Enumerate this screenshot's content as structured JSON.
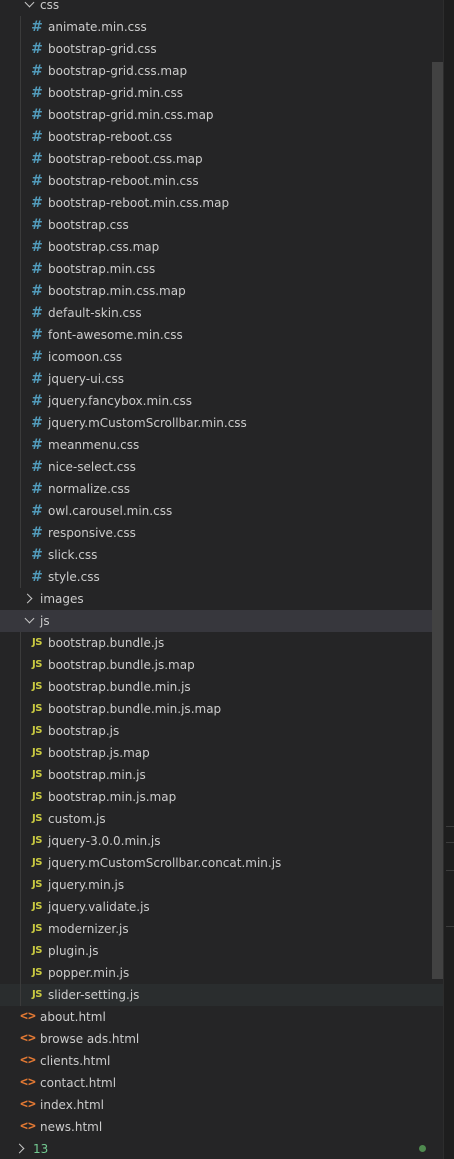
{
  "explorer": {
    "css_folder": {
      "label": "css",
      "expanded": true,
      "icon": "chevron-down-icon"
    },
    "css_files": [
      "animate.min.css",
      "bootstrap-grid.css",
      "bootstrap-grid.css.map",
      "bootstrap-grid.min.css",
      "bootstrap-grid.min.css.map",
      "bootstrap-reboot.css",
      "bootstrap-reboot.css.map",
      "bootstrap-reboot.min.css",
      "bootstrap-reboot.min.css.map",
      "bootstrap.css",
      "bootstrap.css.map",
      "bootstrap.min.css",
      "bootstrap.min.css.map",
      "default-skin.css",
      "font-awesome.min.css",
      "icomoon.css",
      "jquery-ui.css",
      "jquery.fancybox.min.css",
      "jquery.mCustomScrollbar.min.css",
      "meanmenu.css",
      "nice-select.css",
      "normalize.css",
      "owl.carousel.min.css",
      "responsive.css",
      "slick.css",
      "style.css"
    ],
    "css_icon_glyph": "#",
    "images_folder": {
      "label": "images",
      "expanded": false,
      "icon": "chevron-right-icon"
    },
    "js_folder": {
      "label": "js",
      "expanded": true,
      "icon": "chevron-down-icon"
    },
    "js_files": [
      "bootstrap.bundle.js",
      "bootstrap.bundle.js.map",
      "bootstrap.bundle.min.js",
      "bootstrap.bundle.min.js.map",
      "bootstrap.js",
      "bootstrap.js.map",
      "bootstrap.min.js",
      "bootstrap.min.js.map",
      "custom.js",
      "jquery-3.0.0.min.js",
      "jquery.mCustomScrollbar.concat.min.js",
      "jquery.min.js",
      "jquery.validate.js",
      "modernizer.js",
      "plugin.js",
      "popper.min.js",
      "slider-setting.js"
    ],
    "js_icon_glyph": "JS",
    "html_files": [
      "about.html",
      "browse ads.html",
      "clients.html",
      "contact.html",
      "index.html",
      "news.html"
    ],
    "html_icon_glyph": "<>",
    "bottom_item": {
      "label": "13",
      "icon": "chevron-right-icon"
    }
  },
  "colors": {
    "css_icon": "#519aba",
    "js_icon": "#cbcb41",
    "html_icon": "#e37933",
    "text": "#cccccc",
    "background": "#252526",
    "selected_row": "#37373d",
    "hover_row": "#2a2d2e",
    "bottom_label": "#73c991"
  }
}
